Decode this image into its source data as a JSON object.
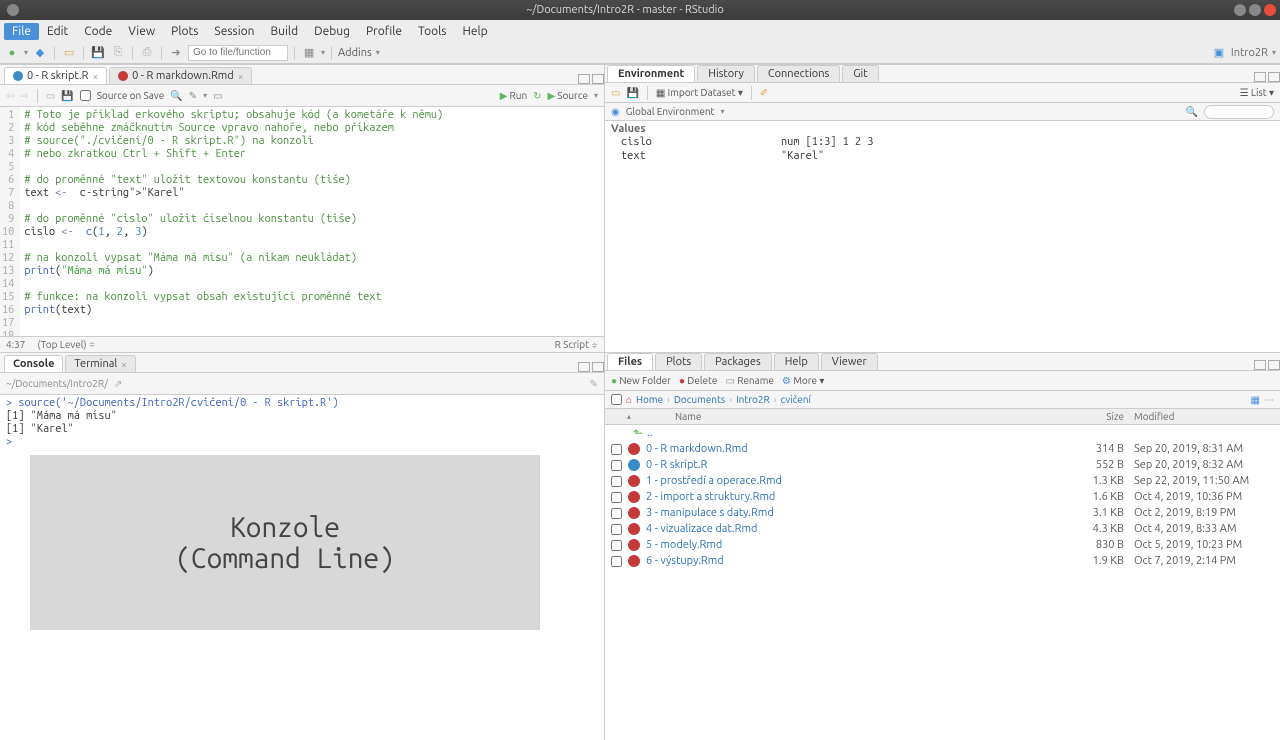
{
  "window": {
    "title": "~/Documents/Intro2R - master - RStudio"
  },
  "menu": {
    "items": [
      "File",
      "Edit",
      "Code",
      "View",
      "Plots",
      "Session",
      "Build",
      "Debug",
      "Profile",
      "Tools",
      "Help"
    ],
    "active": 0
  },
  "toolbar": {
    "goto_placeholder": "Go to file/function",
    "addins": "Addins",
    "project": "Intro2R"
  },
  "source": {
    "tabs": [
      {
        "icon": "r",
        "label": "0 - R skript.R"
      },
      {
        "icon": "rmd",
        "label": "0 - R markdown.Rmd"
      }
    ],
    "toolbar": {
      "source_on_save": "Source on Save",
      "run": "Run",
      "source": "Source"
    },
    "lines": [
      {
        "n": 1,
        "cls": "c-comment",
        "t": "# Toto je příklad erkového skriptu; obsahuje kód (a kometáře k němu)"
      },
      {
        "n": 2,
        "cls": "c-comment",
        "t": "# kód seběhne zmáčknutím Source vpravo nahoře, nebo příkazem"
      },
      {
        "n": 3,
        "cls": "c-comment",
        "t": "# source(\"./cvičení/0 - R skript.R\") na konzoli"
      },
      {
        "n": 4,
        "cls": "c-comment",
        "t": "# nebo zkratkou Ctrl + Shift + Enter"
      },
      {
        "n": 5,
        "cls": "",
        "t": ""
      },
      {
        "n": 6,
        "cls": "c-comment",
        "t": "# do proměnné \"text\" uložit textovou konstantu (tiše)"
      },
      {
        "n": 7,
        "cls": "",
        "t": "text <- \"Karel\""
      },
      {
        "n": 8,
        "cls": "",
        "t": ""
      },
      {
        "n": 9,
        "cls": "c-comment",
        "t": "# do proměnné \"cislo\" uložit číselnou konstantu (tiše)"
      },
      {
        "n": 10,
        "cls": "",
        "t": "cislo <- c(1, 2, 3)"
      },
      {
        "n": 11,
        "cls": "",
        "t": ""
      },
      {
        "n": 12,
        "cls": "c-comment",
        "t": "# na konzoli vypsat \"Máma má mísu\" (a nikam neukládat)"
      },
      {
        "n": 13,
        "cls": "",
        "t": "print(\"Máma má mísu\")"
      },
      {
        "n": 14,
        "cls": "",
        "t": ""
      },
      {
        "n": 15,
        "cls": "c-comment",
        "t": "# funkce: na konzoli vypsat obsah existující proměnné text"
      },
      {
        "n": 16,
        "cls": "",
        "t": "print(text)"
      },
      {
        "n": 17,
        "cls": "",
        "t": ""
      },
      {
        "n": 18,
        "cls": "",
        "t": ""
      }
    ],
    "status": {
      "pos": "4:37",
      "scope": "(Top Level)",
      "type": "R Script"
    }
  },
  "console": {
    "tabs": [
      "Console",
      "Terminal"
    ],
    "path": "~/Documents/Intro2R/",
    "lines": [
      "> source('~/Documents/Intro2R/cvičení/0 - R skript.R')",
      "[1] \"Máma má mísu\"",
      "[1] \"Karel\"",
      "> "
    ],
    "overlay": {
      "l1": "Konzole",
      "l2": "(Command Line)"
    }
  },
  "env": {
    "tabs": [
      "Environment",
      "History",
      "Connections",
      "Git"
    ],
    "toolbar": {
      "import": "Import Dataset",
      "global": "Global Environment",
      "list": "List"
    },
    "section": "Values",
    "vars": [
      {
        "name": "cislo",
        "val": "num [1:3] 1 2 3"
      },
      {
        "name": "text",
        "val": "\"Karel\""
      }
    ]
  },
  "files": {
    "tabs": [
      "Files",
      "Plots",
      "Packages",
      "Help",
      "Viewer"
    ],
    "toolbar": {
      "new_folder": "New Folder",
      "delete": "Delete",
      "rename": "Rename",
      "more": "More"
    },
    "breadcrumb": [
      "Home",
      "Documents",
      "Intro2R",
      "cvičení"
    ],
    "header": {
      "name": "Name",
      "size": "Size",
      "modified": "Modified"
    },
    "up": "..",
    "rows": [
      {
        "icon": "rmd",
        "name": "0 - R markdown.Rmd",
        "size": "314 B",
        "mod": "Sep 20, 2019, 8:31 AM"
      },
      {
        "icon": "r",
        "name": "0 - R skript.R",
        "size": "552 B",
        "mod": "Sep 20, 2019, 8:32 AM"
      },
      {
        "icon": "rmd",
        "name": "1 - prostředí a operace.Rmd",
        "size": "1.3 KB",
        "mod": "Sep 22, 2019, 11:50 AM"
      },
      {
        "icon": "rmd",
        "name": "2 - import a struktury.Rmd",
        "size": "1.6 KB",
        "mod": "Oct 4, 2019, 10:36 PM"
      },
      {
        "icon": "rmd",
        "name": "3 - manipulace s daty.Rmd",
        "size": "3.1 KB",
        "mod": "Oct 2, 2019, 8:19 PM"
      },
      {
        "icon": "rmd",
        "name": "4 - vizualizace dat.Rmd",
        "size": "4.3 KB",
        "mod": "Oct 4, 2019, 8:33 AM"
      },
      {
        "icon": "rmd",
        "name": "5 - modely.Rmd",
        "size": "830 B",
        "mod": "Oct 5, 2019, 10:23 PM"
      },
      {
        "icon": "rmd",
        "name": "6 - výstupy.Rmd",
        "size": "1.9 KB",
        "mod": "Oct 7, 2019, 2:14 PM"
      }
    ]
  }
}
